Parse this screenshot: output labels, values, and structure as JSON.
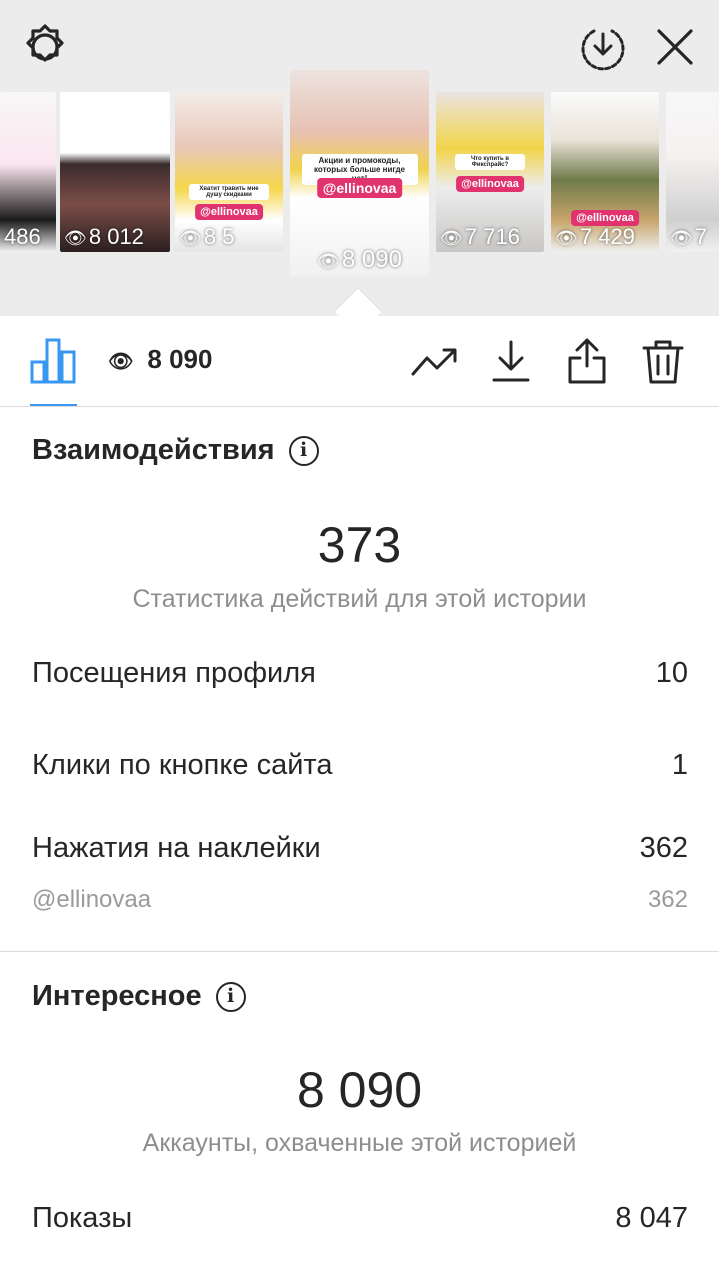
{
  "stories": [
    {
      "views": "486",
      "tag": ""
    },
    {
      "views": "8 012",
      "tag": ""
    },
    {
      "views": "8 5",
      "tag": "@ellinovaa",
      "caption": "Хватит травить мне душу скидками"
    },
    {
      "views": "8 090",
      "tag": "@ellinovaa",
      "caption": "Акции и промокоды, которых больше нигде нет!"
    },
    {
      "views": "7 716",
      "tag": "@ellinovaa",
      "caption": "Что купить в Фикспрайс?"
    },
    {
      "views": "7 429",
      "tag": "@ellinovaa"
    },
    {
      "views": "7",
      "tag": ""
    }
  ],
  "toolbar": {
    "views_count": "8 090"
  },
  "interactions": {
    "title": "Взаимодействия",
    "info_glyph": "i",
    "total": "373",
    "total_caption": "Статистика действий для этой истории",
    "rows": [
      {
        "label": "Посещения профиля",
        "value": "10"
      },
      {
        "label": "Клики по кнопке сайта",
        "value": "1"
      },
      {
        "label": "Нажатия на наклейки",
        "value": "362"
      }
    ],
    "sub_row": {
      "label": "@ellinovaa",
      "value": "362"
    }
  },
  "discovery": {
    "title": "Интересное",
    "info_glyph": "i",
    "total": "8 090",
    "total_caption": "Аккаунты, охваченные этой историей",
    "rows": [
      {
        "label": "Показы",
        "value": "8 047"
      }
    ]
  },
  "colors": {
    "accent": "#3897f0",
    "story_tag": "#e0336f",
    "muted_text": "#8e8e8e"
  }
}
